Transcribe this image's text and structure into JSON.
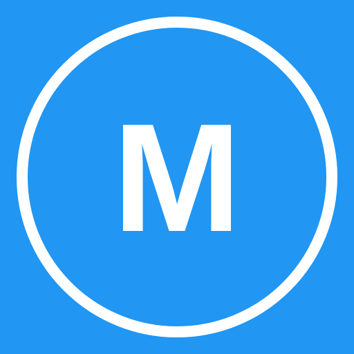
{
  "icon": {
    "letter": "M",
    "background_color": "#2196F3",
    "foreground_color": "#FFFFFF",
    "shape": "circle-outline"
  }
}
